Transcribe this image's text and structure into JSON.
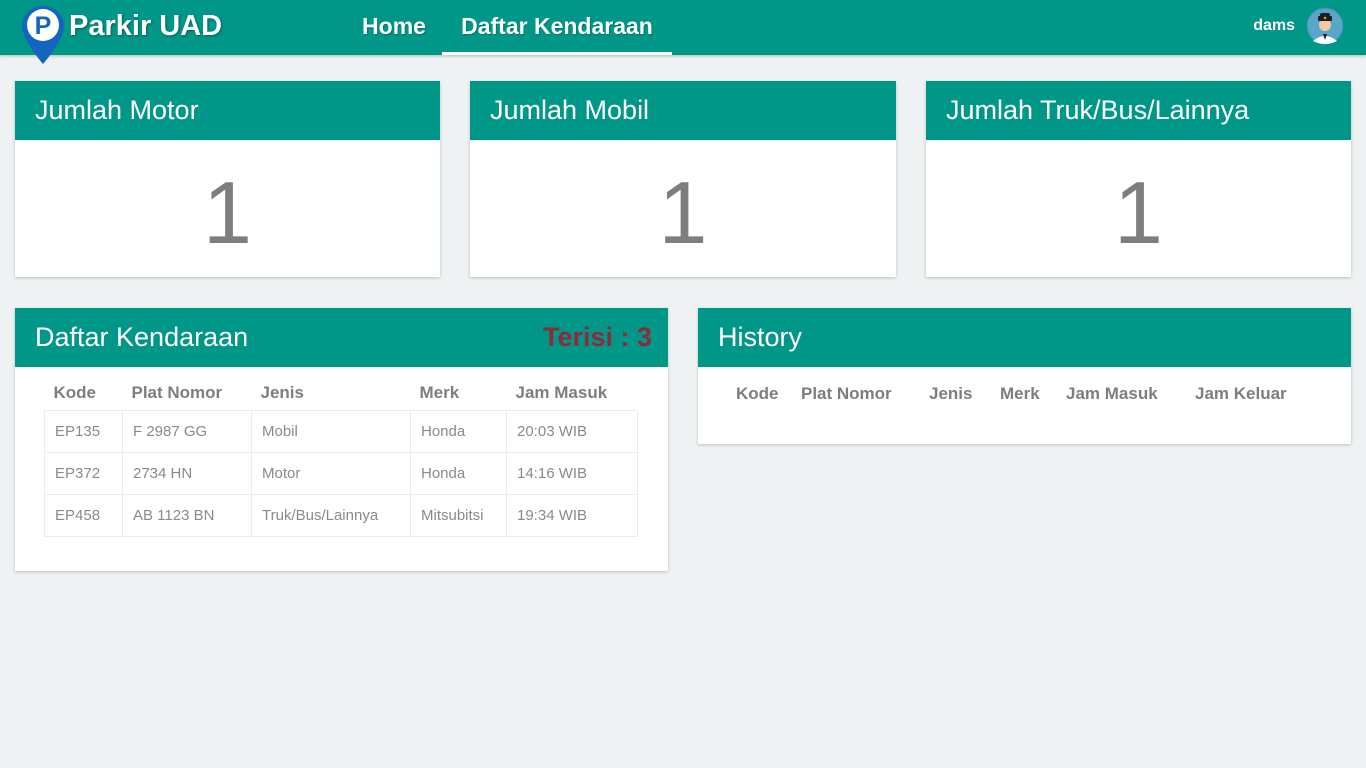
{
  "app": {
    "brand": "Parkir UAD",
    "logo_letter": "P",
    "user": "dams"
  },
  "nav": [
    {
      "label": "Home",
      "active": false
    },
    {
      "label": "Daftar Kendaraan",
      "active": true
    }
  ],
  "stats": [
    {
      "title": "Jumlah Motor",
      "value": "1"
    },
    {
      "title": "Jumlah Mobil",
      "value": "1"
    },
    {
      "title": "Jumlah Truk/Bus/Lainnya",
      "value": "1"
    }
  ],
  "daftar": {
    "title": "Daftar Kendaraan",
    "terisi": "Terisi : 3",
    "columns": [
      "Kode",
      "Plat Nomor",
      "Jenis",
      "Merk",
      "Jam Masuk"
    ],
    "rows": [
      [
        "EP135",
        "F 2987 GG",
        "Mobil",
        "Honda",
        "20:03 WIB"
      ],
      [
        "EP372",
        "2734 HN",
        "Motor",
        "Honda",
        "14:16 WIB"
      ],
      [
        "EP458",
        "AB 1123 BN",
        "Truk/Bus/Lainnya",
        "Mitsubitsi",
        "19:34 WIB"
      ]
    ]
  },
  "history": {
    "title": "History",
    "columns": [
      "Kode",
      "Plat Nomor",
      "Jenis",
      "Merk",
      "Jam Masuk",
      "Jam Keluar"
    ]
  },
  "colors": {
    "primary": "#009688",
    "terisi": "#8e2b3a",
    "background": "#eff2f3",
    "logo_blue": "#1565c0"
  },
  "icons": {
    "logo": "parking-pin-icon",
    "avatar": "security-guard-avatar-icon"
  }
}
